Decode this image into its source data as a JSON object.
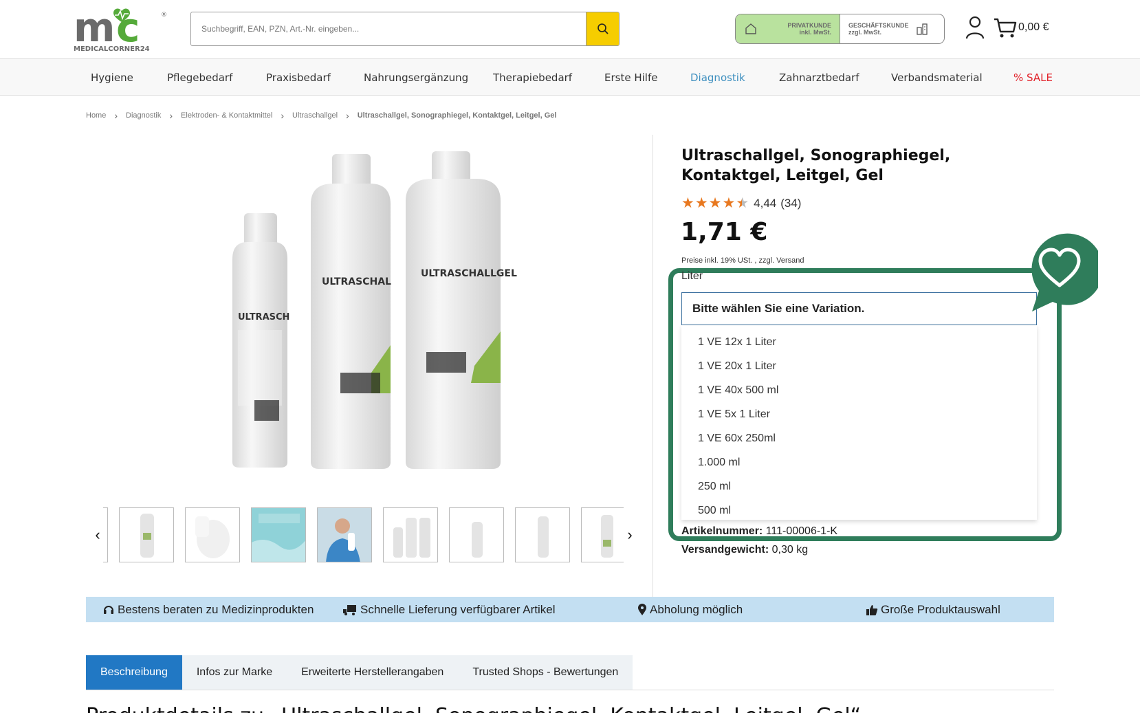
{
  "brand": {
    "logo_text": "MEDICALCORNER24",
    "logo_mark": "mc",
    "accent": "#4aa24a"
  },
  "search": {
    "placeholder": "Suchbegriff, EAN, PZN, Art.-Nr. eingeben...",
    "button_icon": "search-icon"
  },
  "customer_toggle": {
    "private": {
      "line1": "PRIVATKUNDE",
      "line2": "inkl. MwSt.",
      "active": true
    },
    "business": {
      "line1": "GESCHÄFTSKUNDE",
      "line2": "zzgl. MwSt.",
      "active": false
    }
  },
  "header": {
    "account_icon": "user-icon",
    "cart_icon": "cart-icon",
    "cart_total": "0,00 €"
  },
  "nav": [
    "Hygiene",
    "Pflegebedarf",
    "Praxisbedarf",
    "Nahrungsergänzung",
    "Therapiebedarf",
    "Erste Hilfe",
    "Diagnostik",
    "Zahnarztbedarf",
    "Verbandsmaterial",
    "% SALE"
  ],
  "nav_active": "Diagnostik",
  "breadcrumb": [
    "Home",
    "Diagnostik",
    "Elektroden- & Kontaktmittel",
    "Ultraschallgel",
    "Ultraschallgel, Sonographiegel, Kontaktgel, Leitgel, Gel"
  ],
  "product": {
    "title": "Ultraschallgel, Sonographiegel, Kontaktgel, Leitgel, Gel",
    "rating_value": "4,44",
    "rating_count": "(34)",
    "stars": 4.44,
    "price": "1,71 €",
    "price_note": "Preise inkl. 19% USt. , zzgl. Versand",
    "variation_label": "Liter",
    "variation_placeholder": "Bitte wählen Sie eine Variation.",
    "variation_options": [
      "1 VE 12x 1 Liter",
      "1 VE 20x 1 Liter",
      "1 VE 40x 500 ml",
      "1 VE 5x 1 Liter",
      "1 VE 60x 250ml",
      "1.000 ml",
      "250 ml",
      "500 ml"
    ],
    "sku_label": "Artikelnummer:",
    "sku_value": "111-00006-1-K",
    "weight_label": "Versandgewicht:",
    "weight_value": "0,30 kg",
    "bottle_label": "ULTRASCHALLGEL",
    "wishlist_icon": "heart-icon"
  },
  "usp": [
    {
      "icon": "headset-icon",
      "text": "Bestens beraten zu Medizinprodukten"
    },
    {
      "icon": "truck-icon",
      "text": "Schnelle Lieferung verfügbarer Artikel"
    },
    {
      "icon": "map-pin-icon",
      "text": "Abholung möglich"
    },
    {
      "icon": "thumbs-up-icon",
      "text": "Große Produktauswahl"
    }
  ],
  "tabs": [
    "Beschreibung",
    "Infos zur Marke",
    "Erweiterte Herstellerangaben",
    "Trusted Shops - Bewertungen"
  ],
  "section_heading": "Produktdetails zu „Ultraschallgel, Sonographiegel, Kontaktgel, Leitgel, Gel“",
  "colors": {
    "highlight": "#2f7d5b",
    "active_tab": "#2178c4",
    "usp_bar": "#c3dff2",
    "search_button": "#f6cd00",
    "sale": "#e2222a",
    "nav_active": "#3e8fbf"
  }
}
